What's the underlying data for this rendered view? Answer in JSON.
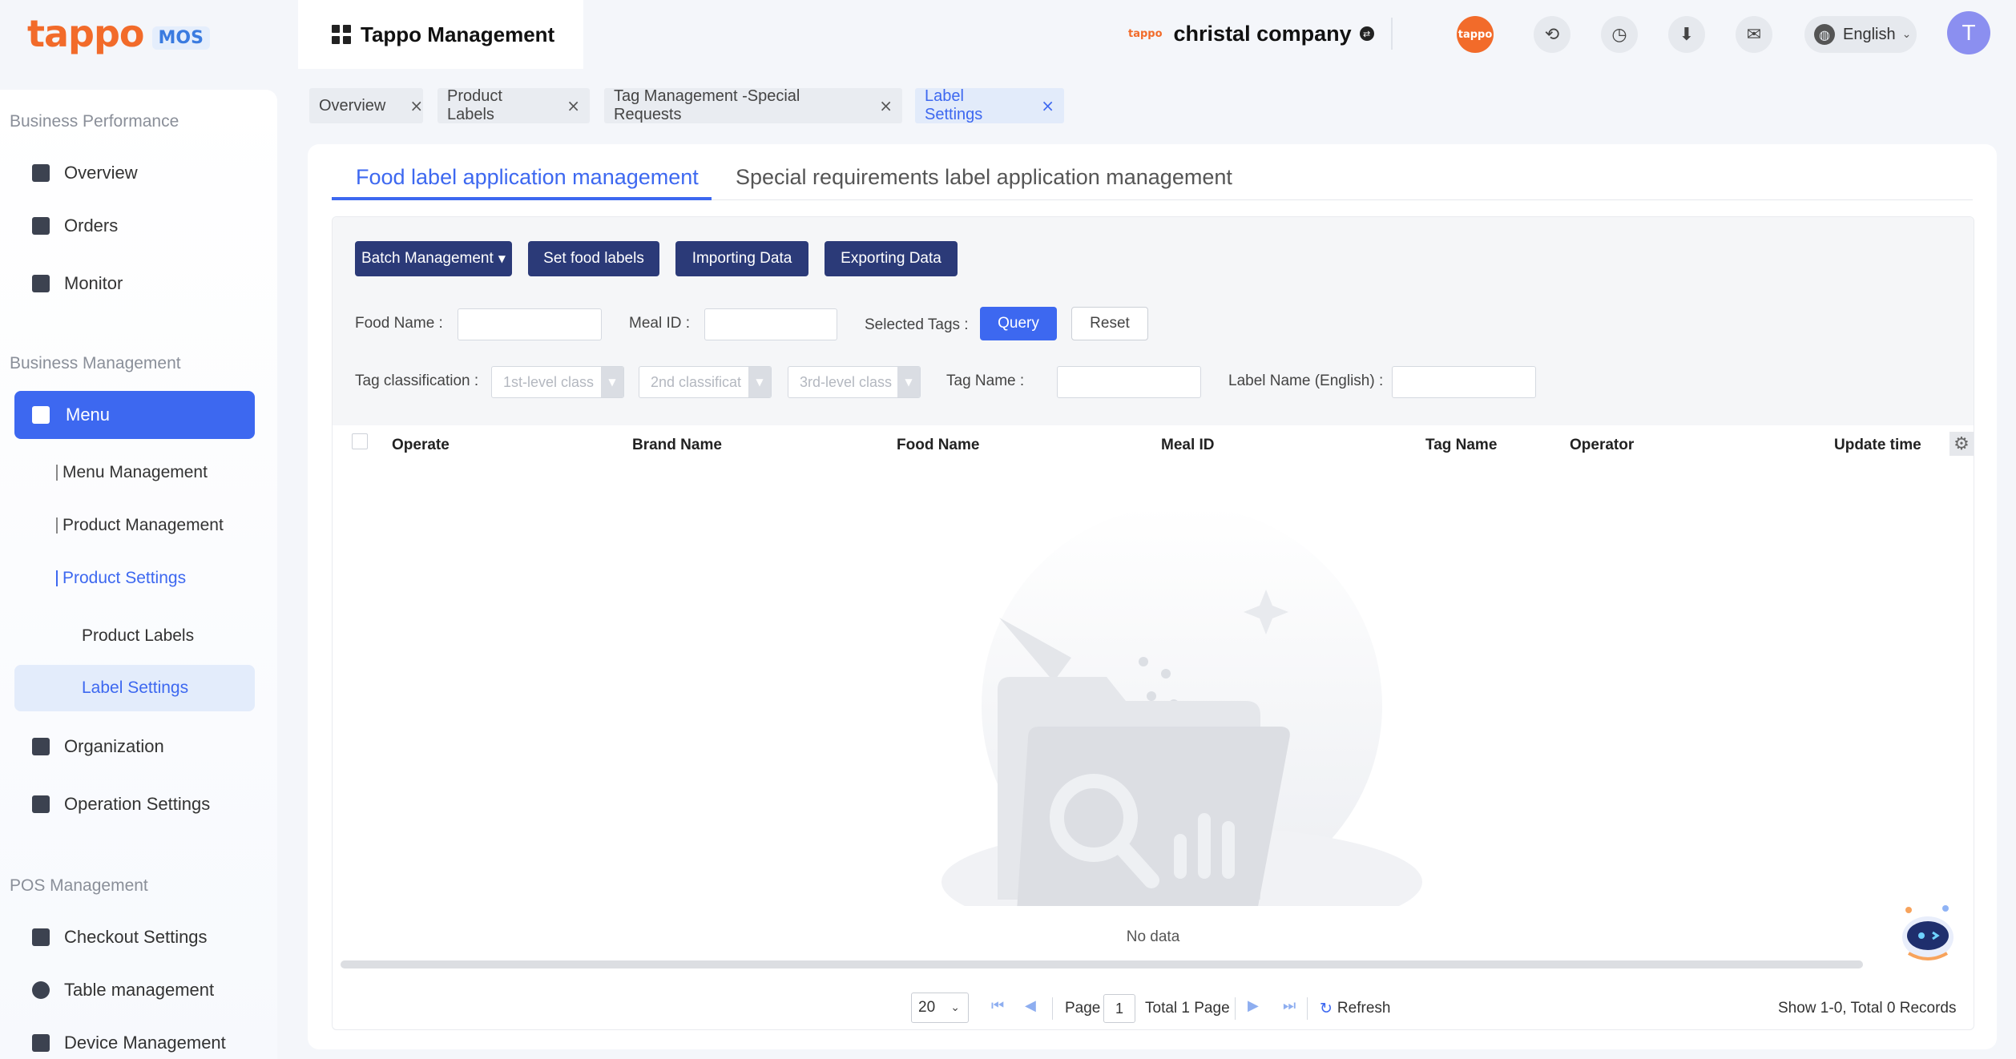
{
  "brand": {
    "logo_text": "tappo",
    "logo_suffix": "MOS",
    "mini_logo": "tappo"
  },
  "app": {
    "title": "Tappo Management"
  },
  "company": {
    "name": "christal company"
  },
  "header_icons": [
    "tappo-badge-icon",
    "sync-icon",
    "history-icon",
    "download-icon",
    "message-icon"
  ],
  "language": {
    "label": "English"
  },
  "user": {
    "avatar_letter": "T"
  },
  "sidebar": {
    "group_business_performance": "Business Performance",
    "overview": "Overview",
    "orders": "Orders",
    "monitor": "Monitor",
    "group_business_management": "Business Management",
    "menu": "Menu",
    "menu_management": "Menu Management",
    "product_management": "Product Management",
    "product_settings": "Product Settings",
    "product_labels": "Product Labels",
    "label_settings": "Label Settings",
    "organization": "Organization",
    "operation_settings": "Operation Settings",
    "group_pos_management": "POS Management",
    "checkout_settings": "Checkout Settings",
    "table_management": "Table management",
    "device_management": "Device Management"
  },
  "page_tabs": [
    {
      "label": "Overview",
      "active": false
    },
    {
      "label": "Product Labels",
      "active": false
    },
    {
      "label": "Tag Management -Special Requests",
      "active": false
    },
    {
      "label": "Label Settings",
      "active": true
    }
  ],
  "content_tabs": {
    "food": "Food label application management",
    "special": "Special requirements label application management"
  },
  "toolbar": {
    "batch": "Batch Management",
    "set_labels": "Set food labels",
    "importing": "Importing Data",
    "exporting": "Exporting Data"
  },
  "filters": {
    "food_name": "Food Name :",
    "meal_id": "Meal ID :",
    "selected_tags": "Selected Tags :",
    "query": "Query",
    "reset": "Reset",
    "tag_classification": "Tag classification :",
    "level1_placeholder": "1st-level class",
    "level2_placeholder": "2nd classificat",
    "level3_placeholder": "3rd-level class",
    "tag_name": "Tag Name :",
    "label_name_en": "Label Name (English) :"
  },
  "table": {
    "columns": [
      "Operate",
      "Brand Name",
      "Food Name",
      "Meal ID",
      "Tag Name",
      "Operator",
      "Update time"
    ],
    "empty_text": "No data"
  },
  "pagination": {
    "page_size": "20",
    "page_label": "Page",
    "current_page": "1",
    "total_label": "Total 1 Page",
    "refresh": "Refresh",
    "summary": "Show 1-0,  Total 0 Records"
  }
}
